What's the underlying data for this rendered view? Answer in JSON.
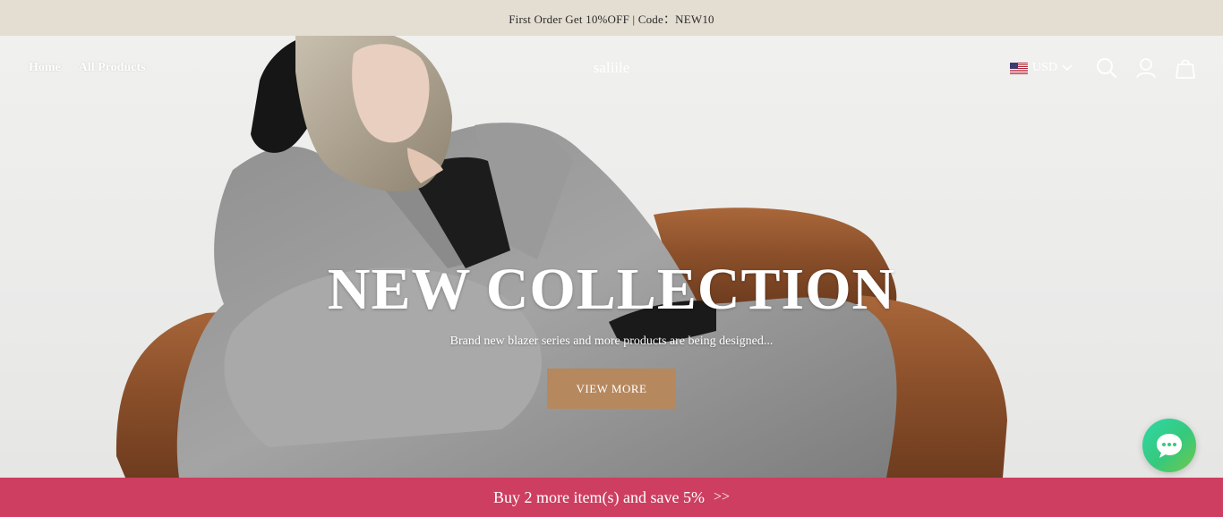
{
  "announcement": {
    "text": "First Order Get 10%OFF | Code：NEW10"
  },
  "nav": {
    "items": [
      "Home",
      "All Products"
    ]
  },
  "brand": {
    "logo": "saliile"
  },
  "header": {
    "currency": "USD",
    "icons": [
      "us-flag-icon",
      "chevron-down-icon",
      "search-icon",
      "account-icon",
      "cart-bag-icon"
    ]
  },
  "hero": {
    "title": "NEW COLLECTION",
    "subtitle": "Brand new blazer series and more products are being designed...",
    "button_label": "VIEW MORE"
  },
  "promo_bar": {
    "text": "Buy 2 more item(s) and save 5%",
    "arrows": ">>"
  },
  "colors": {
    "announcement_bg": "#e4ddd2",
    "button_bg": "#b6885e",
    "promo_bg": "#cd3e60",
    "chat_gradient": [
      "#2fd7a6",
      "#71c84a"
    ]
  }
}
